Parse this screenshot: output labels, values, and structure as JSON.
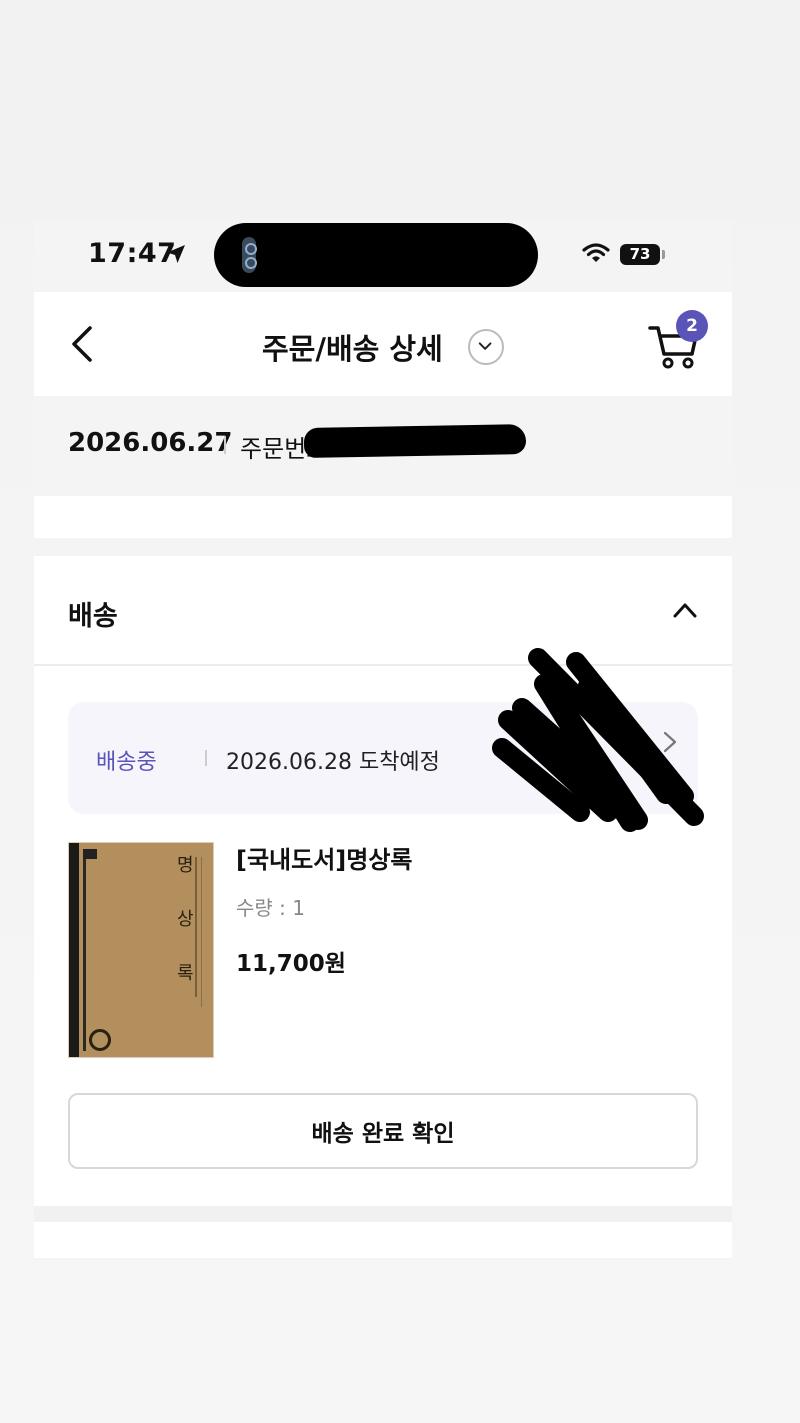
{
  "status_bar": {
    "time": "17:47",
    "battery": "73",
    "icons": [
      "location-arrow-icon",
      "wifi-icon",
      "battery-icon"
    ]
  },
  "header": {
    "title": "주문/배송 상세",
    "cart_count": "2",
    "icons": [
      "back-arrow-icon",
      "chevron-down-icon",
      "cart-icon"
    ]
  },
  "order": {
    "date": "2026.06.27",
    "number_label": "주문번호"
  },
  "delivery": {
    "section_title": "배송",
    "status": "배송중",
    "eta": "2026.06.28 도착예정",
    "accent_color": "#5a53b8"
  },
  "product": {
    "title": "[국내도서]명상록",
    "quantity": "수량 : 1",
    "price": "11,700원",
    "cover_text": [
      "명",
      "상",
      "록"
    ]
  },
  "actions": {
    "confirm_label": "배송 완료 확인"
  }
}
